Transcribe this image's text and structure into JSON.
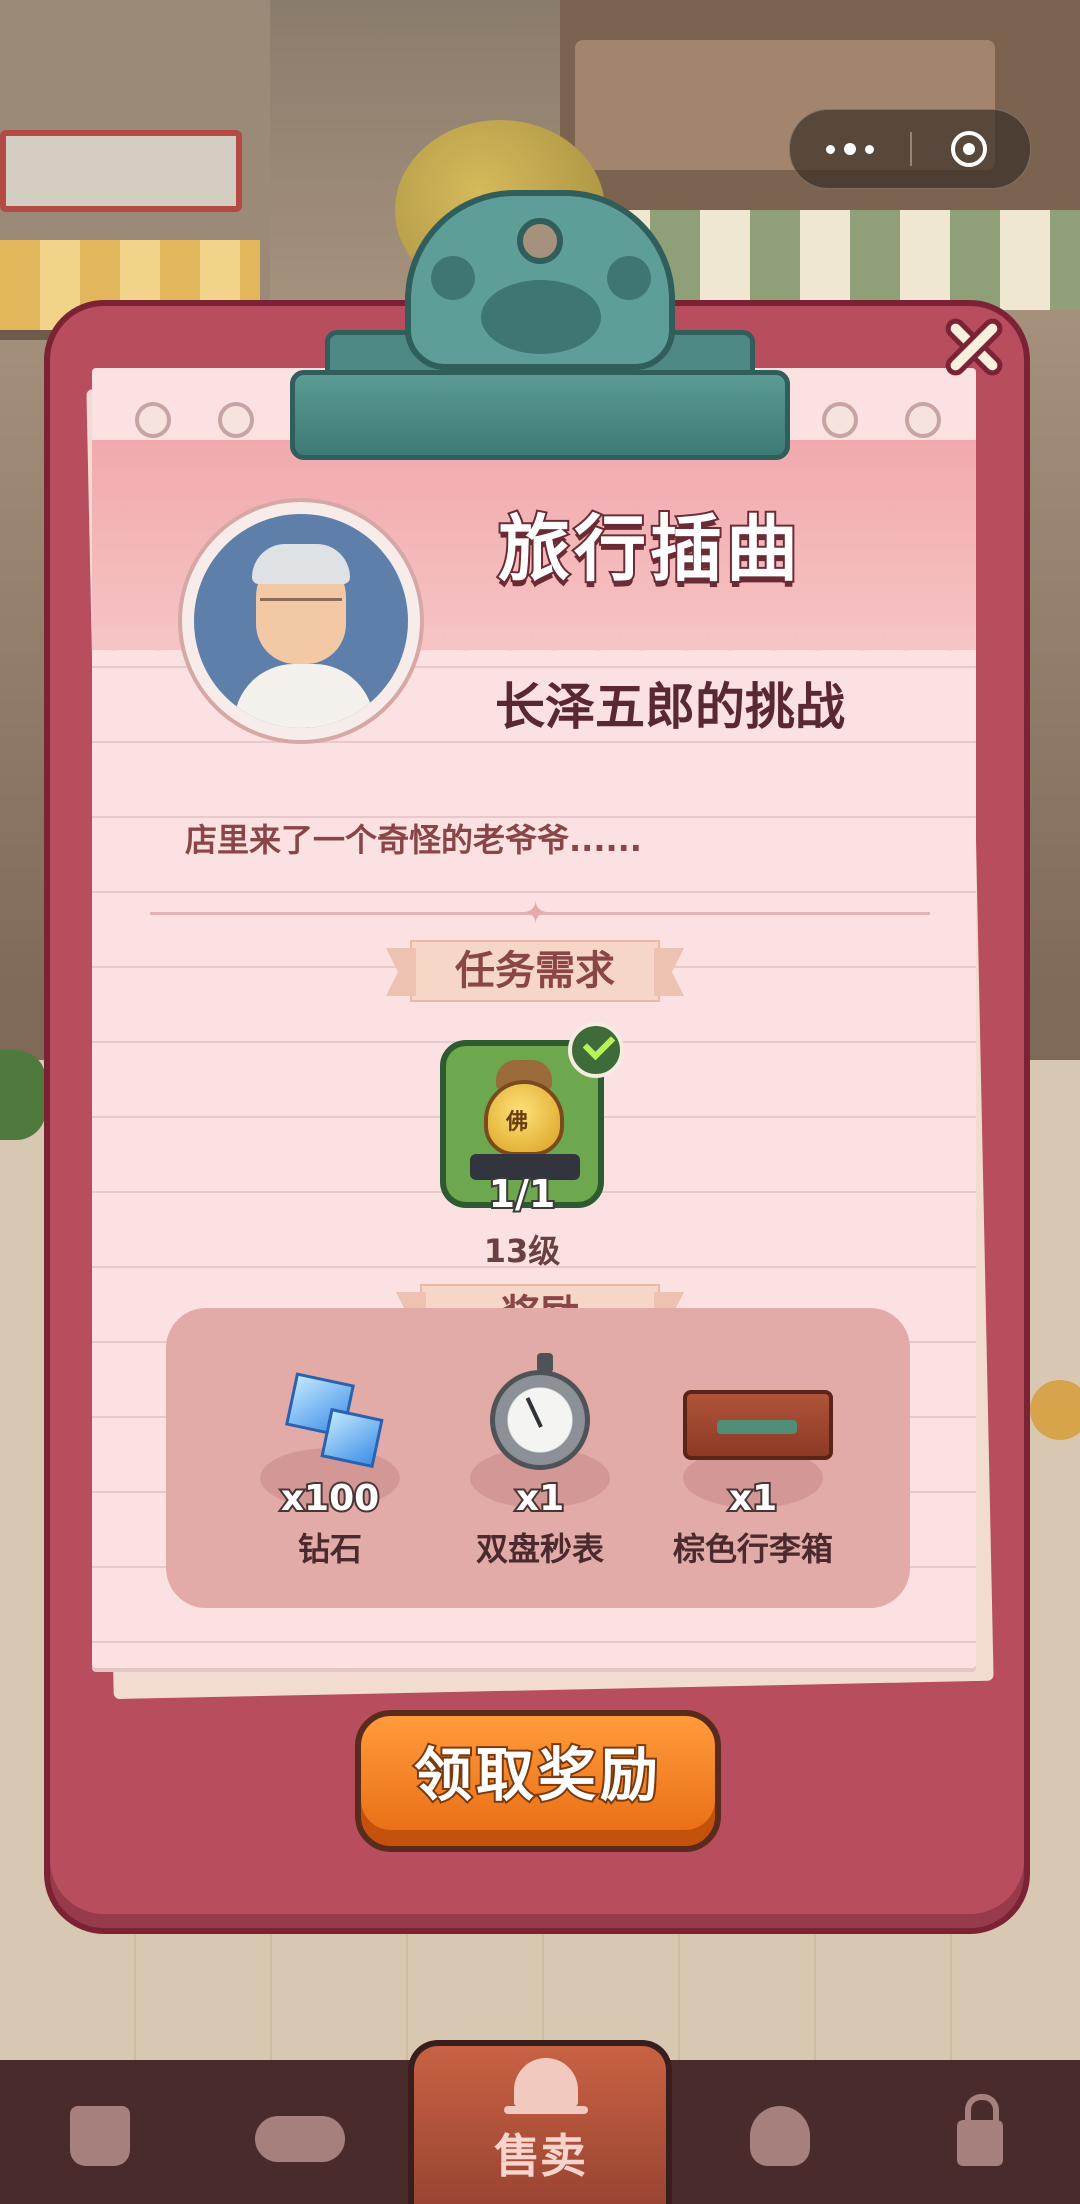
{
  "panel": {
    "title": "旅行插曲",
    "subtitle": "长泽五郎的挑战",
    "description": "店里来了一个奇怪的老爷爷......"
  },
  "task": {
    "section_label": "任务需求",
    "item_icon": "golden-pot-icon",
    "item_char": "佛",
    "progress": "1/1",
    "level": "13级",
    "completed": true
  },
  "rewards": {
    "section_label": "奖励",
    "items": [
      {
        "icon": "diamond-icon",
        "quantity": "x100",
        "name": "钻石"
      },
      {
        "icon": "stopwatch-icon",
        "quantity": "x1",
        "name": "双盘秒表"
      },
      {
        "icon": "suitcase-icon",
        "quantity": "x1",
        "name": "棕色行李箱"
      }
    ]
  },
  "claim_button": "领取奖励",
  "bottom_nav": {
    "items": [
      {
        "icon": "shopping-bag-icon"
      },
      {
        "icon": "handshake-icon"
      },
      {
        "icon": "bell-icon",
        "label": "售卖",
        "active": true
      },
      {
        "icon": "map-pin-icon"
      },
      {
        "icon": "lock-icon"
      }
    ]
  },
  "colors": {
    "board": "#b84d5e",
    "paper": "#fbe1e2",
    "clip": "#5e9e98",
    "claim_button": "#f28a2a",
    "nav_background": "#4a2b2b"
  }
}
